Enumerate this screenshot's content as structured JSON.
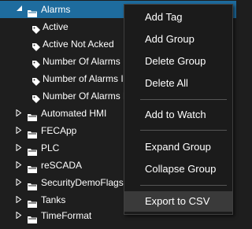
{
  "tree": {
    "root": {
      "label": "Alarms",
      "expanded": true,
      "selected": true
    },
    "tags": [
      {
        "label": "Active"
      },
      {
        "label": "Active Not Acked"
      },
      {
        "label": "Number Of Alarms"
      },
      {
        "label": "Number of Alarms In L"
      },
      {
        "label": "Number Of Alarms No"
      }
    ],
    "groups": [
      {
        "label": "Automated HMI"
      },
      {
        "label": "FECApp"
      },
      {
        "label": "PLC"
      },
      {
        "label": "reSCADA"
      },
      {
        "label": "SecurityDemoFlags"
      },
      {
        "label": "Tanks"
      },
      {
        "label": "TimeFormat"
      }
    ]
  },
  "context_menu": {
    "add_tag": "Add Tag",
    "add_group": "Add Group",
    "delete_group": "Delete Group",
    "delete_all": "Delete All",
    "add_to_watch": "Add to Watch",
    "expand_group": "Expand Group",
    "collapse_group": "Collapse Group",
    "export_csv": "Export to CSV",
    "hovered_item": "Export to CSV"
  },
  "icons": {
    "expanded_arrow": "expanded-arrow-icon",
    "collapsed_arrow": "collapsed-arrow-icon",
    "folder": "folder-icon",
    "tag": "tag-icon"
  },
  "colors": {
    "background": "#1e1e1e",
    "selection": "#1e6c9e",
    "menu_background": "#1b1b1b",
    "menu_hover": "#3a3a3a",
    "text": "#ffffff"
  }
}
